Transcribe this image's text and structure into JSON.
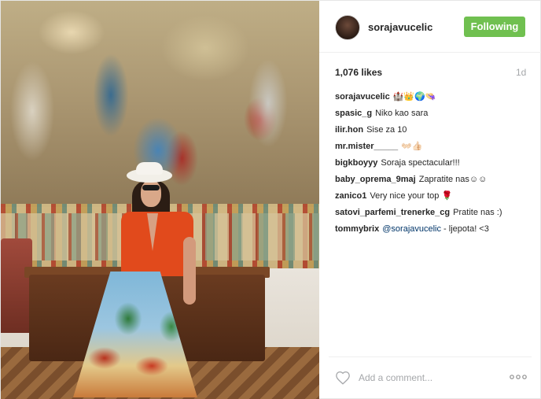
{
  "post": {
    "author": "sorajavucelic",
    "follow_label": "Following",
    "likes": "1,076 likes",
    "time": "1d",
    "caption": {
      "user": "sorajavucelic",
      "text": "🏰👑🌍👒"
    },
    "comments": [
      {
        "user": "spasic_g",
        "text": "Niko kao sara"
      },
      {
        "user": "ilir.hon",
        "text": "Sise za 10"
      },
      {
        "user": "mr.mister_____",
        "text": "👐🏻👍🏻"
      },
      {
        "user": "bigkboyyy",
        "text": "Soraja spectacular!!!"
      },
      {
        "user": "baby_oprema_9maj",
        "text": "Zapratite nas☺☺"
      },
      {
        "user": "zanico1",
        "text": "Very nice your top 🌹"
      },
      {
        "user": "satovi_parfemi_trenerke_cg",
        "text": "Pratite nas :)"
      },
      {
        "user": "tommybrix",
        "mention": "@sorajavucelic",
        "text": " - ljepota! <3"
      }
    ],
    "add_comment_placeholder": "Add a comment...",
    "icons": {
      "like": "heart-icon",
      "more": "more-options-icon"
    },
    "colors": {
      "follow_button": "#70c050",
      "mention": "#003569",
      "muted": "#a5a7aa"
    }
  }
}
